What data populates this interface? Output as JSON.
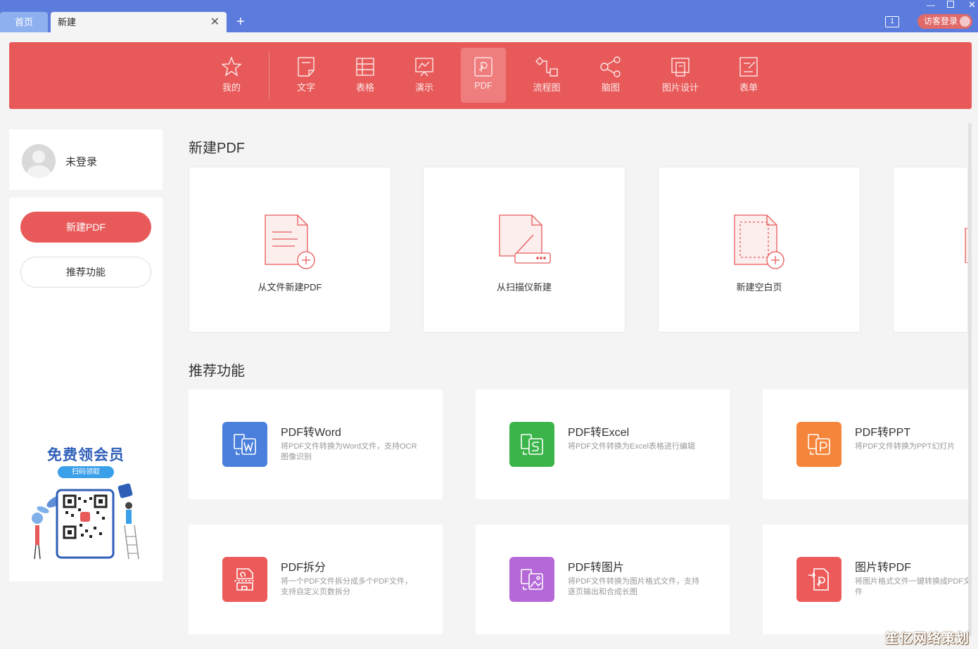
{
  "tabs": {
    "home": "首页",
    "current": "新建"
  },
  "window": {
    "badge": "1",
    "login_label": "访客登录"
  },
  "categories": [
    {
      "label": "我的",
      "icon": "star-icon"
    },
    {
      "label": "文字",
      "icon": "document-icon"
    },
    {
      "label": "表格",
      "icon": "table-icon"
    },
    {
      "label": "演示",
      "icon": "presentation-icon"
    },
    {
      "label": "PDF",
      "icon": "pdf-icon",
      "active": true
    },
    {
      "label": "流程图",
      "icon": "flowchart-icon"
    },
    {
      "label": "脑图",
      "icon": "mindmap-icon"
    },
    {
      "label": "图片设计",
      "icon": "image-design-icon"
    },
    {
      "label": "表单",
      "icon": "form-icon"
    }
  ],
  "user": {
    "name": "未登录"
  },
  "sidebar": {
    "new_pdf": "新建PDF",
    "recommended": "推荐功能",
    "promo_title": "免费领会员",
    "promo_button": "扫码领取"
  },
  "main": {
    "new_section_title": "新建PDF",
    "new_options": [
      {
        "label": "从文件新建PDF"
      },
      {
        "label": "从扫描仪新建"
      },
      {
        "label": "新建空白页"
      }
    ],
    "recommended_title": "推荐功能",
    "features": [
      {
        "name": "PDF转Word",
        "desc": "将PDF文件转换为Word文件，支持OCR图像识别",
        "color": "#4a7fdc"
      },
      {
        "name": "PDF转Excel",
        "desc": "将PDF文件转换为Excel表格进行编辑",
        "color": "#3bb44a"
      },
      {
        "name": "PDF转PPT",
        "desc": "将PDF文件转换为PPT幻灯片",
        "color": "#f5853a"
      },
      {
        "name": "PDF拆分",
        "desc": "将一个PDF文件拆分成多个PDF文件，支持自定义页数拆分",
        "color": "#ec5a5a"
      },
      {
        "name": "PDF转图片",
        "desc": "将PDF文件转换为图片格式文件，支持逐页输出和合成长图",
        "color": "#b568d8"
      },
      {
        "name": "图片转PDF",
        "desc": "将图片格式文件一键转换成PDF文件",
        "color": "#ec5a5a"
      }
    ]
  },
  "watermark": "笙亿网络策划"
}
